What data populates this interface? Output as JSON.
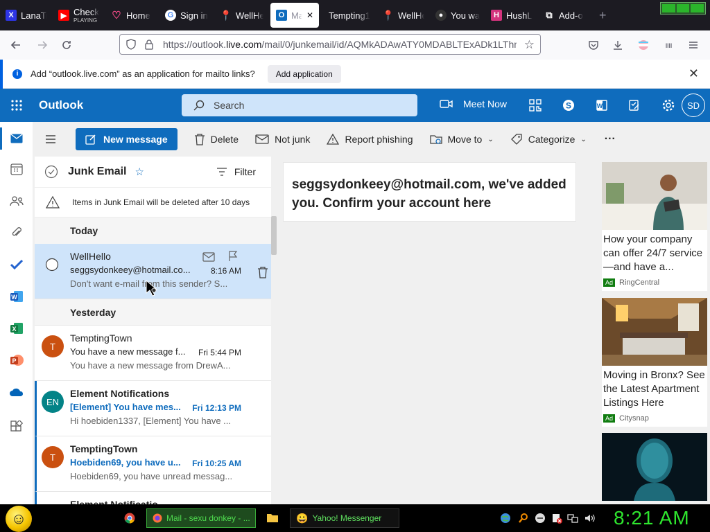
{
  "browser": {
    "tabs": [
      {
        "label": "LanaTr",
        "icon": "x-icon",
        "color": "#2e35e6"
      },
      {
        "label": "Check",
        "sub": "PLAYING",
        "icon": "youtube-icon",
        "color": "#ff0000"
      },
      {
        "label": "Home",
        "icon": "heart-icon",
        "color": "#ff4d8d"
      },
      {
        "label": "Sign in",
        "icon": "google-icon",
        "color": "#4285f4"
      },
      {
        "label": "WellHe",
        "icon": "pin-icon",
        "color": "#c0392b"
      },
      {
        "label": "Mai",
        "icon": "outlook-icon",
        "color": "#0f6cbd",
        "active": true
      },
      {
        "label": "Tempting1",
        "icon": "",
        "color": "#1c1b22"
      },
      {
        "label": "WellHe",
        "icon": "pin-icon",
        "color": "#c0392b"
      },
      {
        "label": "You wa",
        "icon": "github-icon",
        "color": "#333"
      },
      {
        "label": "HushL",
        "icon": "hush-icon",
        "color": "#d3337d"
      },
      {
        "label": "Add-o",
        "icon": "addon-icon",
        "color": "#fff"
      }
    ],
    "new_tab": "+",
    "url": {
      "prefix": "https://outlook.",
      "host": "live.com",
      "path": "/mail/0/junkemail/id/AQMkADAwATY0MDABLTExADk1LThm"
    }
  },
  "notification": {
    "text": "Add “outlook.live.com” as an application for mailto links?",
    "button": "Add application",
    "close": "✕"
  },
  "outlook": {
    "brand": "Outlook",
    "search_placeholder": "Search",
    "meet_now": "Meet Now",
    "avatar_initials": "SD"
  },
  "commands": {
    "new_message": "New message",
    "delete": "Delete",
    "not_junk": "Not junk",
    "report_phishing": "Report phishing",
    "move_to": "Move to",
    "categorize": "Categorize",
    "more": "···"
  },
  "folder": {
    "name": "Junk Email",
    "filter": "Filter",
    "junk_note": "Items in Junk Email will be deleted after 10 days",
    "groups": {
      "today": "Today",
      "yesterday": "Yesterday"
    }
  },
  "messages": [
    {
      "from": "WellHello",
      "subject": "seggsydonkeey@hotmail.co...",
      "time": "8:16 AM",
      "preview": "Don't want e-mail from this sender? S..."
    },
    {
      "from": "TemptingTown",
      "initials": "T",
      "avatar_color": "#ca5010",
      "subject": "You have a new message f...",
      "time": "Fri 5:44 PM",
      "preview": "You have a new message from DrewA..."
    },
    {
      "from": "Element Notifications",
      "initials": "EN",
      "avatar_color": "#038387",
      "subject": "[Element] You have mes...",
      "time": "Fri 12:13 PM",
      "preview": "Hi hoebiden1337, [Element] You have ..."
    },
    {
      "from": "TemptingTown",
      "initials": "T",
      "avatar_color": "#ca5010",
      "subject": "Hoebiden69, you have u...",
      "time": "Fri 10:25 AM",
      "preview": "Hoebiden69, you have unread messag..."
    },
    {
      "from": "Element Notificatio"
    }
  ],
  "reading_pane": {
    "subject": "seggsydonkeey@hotmail.com, we've added you. Confirm your account here"
  },
  "ads": [
    {
      "text": "How your company can offer 24/7 service—and have a...",
      "badge": "Ad",
      "source": "RingCentral"
    },
    {
      "text": "Moving in Bronx? See the Latest Apartment Listings Here",
      "badge": "Ad",
      "source": "Citysnap"
    }
  ],
  "taskbar": {
    "mail_window": "Mail - sexu donkey - ...",
    "yahoo_window": "Yahoo! Messenger",
    "clock": "8:21 AM"
  }
}
